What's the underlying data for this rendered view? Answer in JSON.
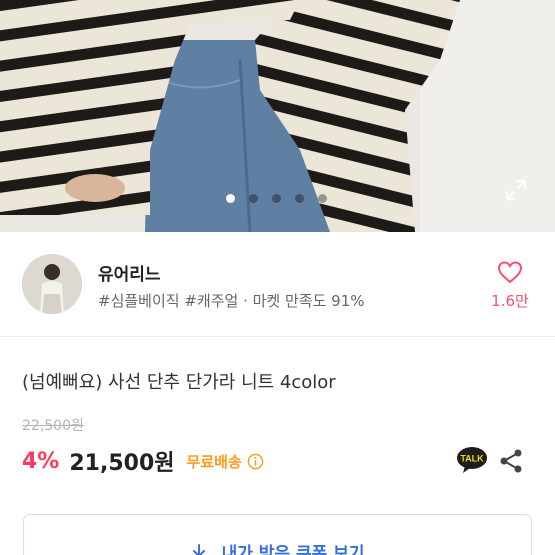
{
  "hero": {
    "slide_count": 5,
    "active_slide": 1,
    "expand_icon": "expand-icon",
    "photo_subject": "striped knit sweater with jeans"
  },
  "seller": {
    "name": "유어리느",
    "tags": "#심플베이직 #캐주얼 · 마켓 만족도 91%",
    "like_count": "1.6만",
    "heart_icon": "heart-outline-icon"
  },
  "product": {
    "title": "(넘예뻐요) 사선 단추 단가라 니트 4color",
    "original_price": "22,500원",
    "discount": "4%",
    "price": "21,500원",
    "shipping": "무료배송",
    "talk_label": "TALK"
  },
  "coupon": {
    "label": "내가 받은 쿠폰 보기"
  },
  "colors": {
    "discount": "#ff3b5c",
    "shipping": "#ff9a1f",
    "coupon": "#3a6fd8",
    "like": "#ff4d6d"
  }
}
